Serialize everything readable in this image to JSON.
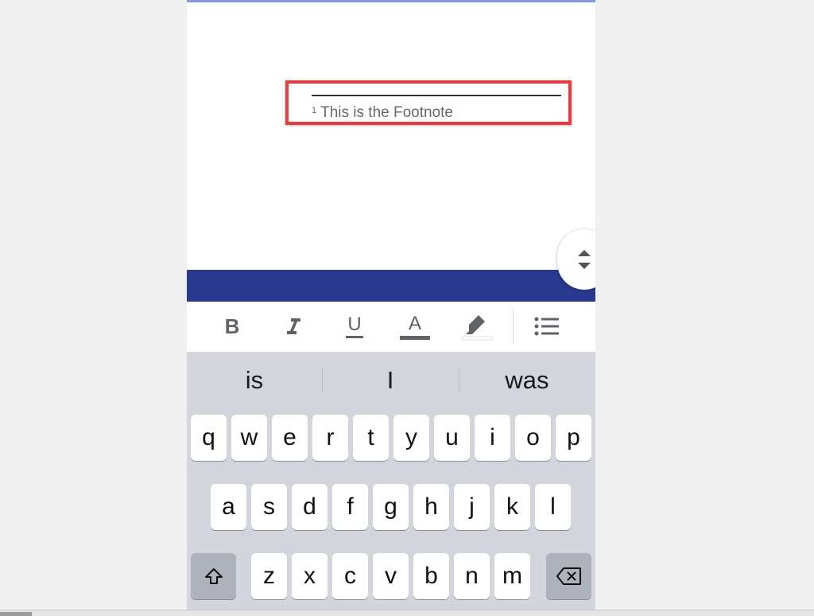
{
  "document": {
    "footnote_number": "1",
    "footnote_text": "This is the Footnote"
  },
  "format_toolbar": {
    "bold_label": "B",
    "underline_label": "U",
    "text_color_label": "A",
    "icons": [
      "italic-icon",
      "text-color-icon",
      "highlighter-icon",
      "bulleted-list-icon"
    ]
  },
  "keyboard": {
    "suggestions": [
      "is",
      "I",
      "was"
    ],
    "rows": [
      [
        "q",
        "w",
        "e",
        "r",
        "t",
        "y",
        "u",
        "i",
        "o",
        "p"
      ],
      [
        "a",
        "s",
        "d",
        "f",
        "g",
        "h",
        "j",
        "k",
        "l"
      ],
      [
        "z",
        "x",
        "c",
        "v",
        "b",
        "n",
        "m"
      ]
    ],
    "special_icons": [
      "shift-icon",
      "backspace-icon"
    ]
  },
  "colors": {
    "highlight_box": "#f0383f",
    "blue_bar": "#2a3990",
    "keyboard_bg": "#d2d5db"
  }
}
